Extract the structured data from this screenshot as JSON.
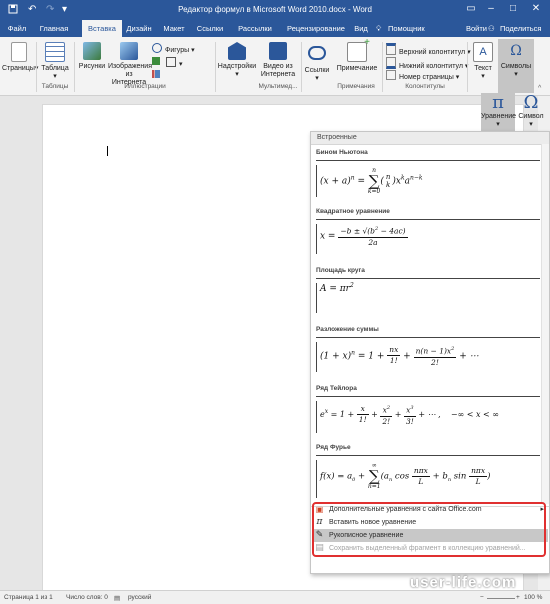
{
  "titlebar": {
    "title": "Редактор формул в Microsoft Word 2010.docx - Word",
    "icons": [
      "save-icon",
      "undo-icon",
      "redo-icon",
      "customize-icon"
    ],
    "window_controls": [
      "restore-ribbon-icon",
      "minimize-icon",
      "maximize-icon",
      "close-icon"
    ]
  },
  "menu": {
    "tabs": [
      "Файл",
      "Главная",
      "Вставка",
      "Дизайн",
      "Макет",
      "Ссылки",
      "Рассылки",
      "Рецензирование",
      "Вид"
    ],
    "active_tab": "Вставка",
    "search": "Помощник",
    "user": "Войти",
    "share": "Поделиться"
  },
  "ribbon": {
    "pages": "Страницы",
    "table": "Таблица",
    "tables_group": "Таблицы",
    "pictures": "Рисунки",
    "online_pictures_1": "Изображения",
    "online_pictures_2": "из Интернета",
    "shapes": "Фигуры",
    "illustrations_group": "Иллюстрации",
    "addins": "Надстройки",
    "video_1": "Видео из",
    "video_2": "Интернета",
    "multimedia_group": "Мультимед...",
    "links": "Ссылки",
    "comment": "Примечание",
    "comments_group": "Примечания",
    "header": "Верхний колонтитул",
    "footer": "Нижний колонтитул",
    "page_number": "Номер страницы",
    "hf_group": "Колонтитулы",
    "text": "Текст",
    "symbols": "Символы"
  },
  "symbols_sub": {
    "equation": "Уравнение",
    "symbol": "Символ",
    "pi_glyph": "π",
    "omega_glyph": "Ω"
  },
  "gallery": {
    "header": "Встроенные",
    "equations": [
      {
        "title": "Бином Ньютона"
      },
      {
        "title": "Квадратное уравнение"
      },
      {
        "title": "Площадь круга"
      },
      {
        "title": "Разложение суммы"
      },
      {
        "title": "Ряд Тейлора"
      },
      {
        "title": "Ряд Фурье"
      }
    ]
  },
  "menu_items": [
    {
      "label": "Дополнительные уравнения с сайта Office.com",
      "icon": "office-icon"
    },
    {
      "label": "Вставить новое уравнение",
      "icon": "pi-icon"
    },
    {
      "label": "Рукописное уравнение",
      "icon": "ink-equation-icon"
    },
    {
      "label": "Сохранить выделенный фрагмент в коллекцию уравнений...",
      "icon": "save-selection-icon"
    }
  ],
  "status": {
    "page": "Страница 1 из 1",
    "words": "Число слов: 0",
    "language": "русский",
    "zoom": "100 %"
  },
  "watermark": "user-life.com",
  "colors": {
    "brand": "#2b579a",
    "highlight": "#e03030"
  }
}
